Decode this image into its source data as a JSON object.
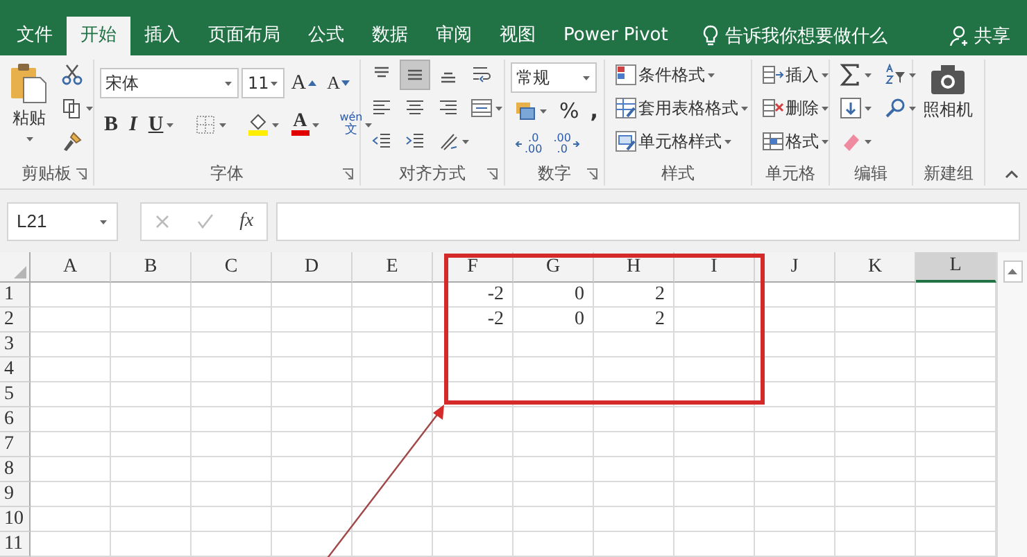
{
  "tabs": [
    {
      "label": "文件",
      "selected": false
    },
    {
      "label": "开始",
      "selected": true
    },
    {
      "label": "插入",
      "selected": false
    },
    {
      "label": "页面布局",
      "selected": false
    },
    {
      "label": "公式",
      "selected": false
    },
    {
      "label": "数据",
      "selected": false
    },
    {
      "label": "审阅",
      "selected": false
    },
    {
      "label": "视图",
      "selected": false
    },
    {
      "label": "Power Pivot",
      "selected": false
    }
  ],
  "tell_me": "告诉我你想要做什么",
  "share": "共享",
  "clipboard": {
    "paste": "粘贴",
    "label": "剪贴板"
  },
  "font": {
    "name": "宋体",
    "size": "11",
    "grow": "A",
    "shrink": "A",
    "bold": "B",
    "italic": "I",
    "underline": "U",
    "color_letter": "A",
    "phonetic_top": "wén",
    "phonetic_bottom": "文",
    "label": "字体"
  },
  "alignment": {
    "vertical": [
      {
        "selected": false
      },
      {
        "selected": true
      },
      {
        "selected": false
      }
    ],
    "label": "对齐方式"
  },
  "number": {
    "format": "常规",
    "percent": "%",
    "comma": ",",
    "increase_decimal": [
      ".0",
      ".00"
    ],
    "decrease_decimal": [
      ".00",
      ".0"
    ],
    "label": "数字"
  },
  "styles": {
    "items": [
      "条件格式",
      "套用表格格式",
      "单元格样式"
    ],
    "label": "样式"
  },
  "cells": {
    "items": [
      "插入",
      "删除",
      "格式"
    ],
    "label": "单元格"
  },
  "editing": {
    "label": "编辑"
  },
  "new_group": {
    "camera": "照相机",
    "label": "新建组"
  },
  "formula_bar": {
    "name_box": "L21",
    "function": "fx"
  },
  "sheet": {
    "columns": [
      {
        "label": "A",
        "selected": false
      },
      {
        "label": "B",
        "selected": false
      },
      {
        "label": "C",
        "selected": false
      },
      {
        "label": "D",
        "selected": false
      },
      {
        "label": "E",
        "selected": false
      },
      {
        "label": "F",
        "selected": false
      },
      {
        "label": "G",
        "selected": false
      },
      {
        "label": "H",
        "selected": false
      },
      {
        "label": "I",
        "selected": false
      },
      {
        "label": "J",
        "selected": false
      },
      {
        "label": "K",
        "selected": false
      },
      {
        "label": "L",
        "selected": true
      }
    ],
    "rows": [
      {
        "label": "1",
        "cells": [
          null,
          null,
          null,
          null,
          null,
          "-2",
          "0",
          "2"
        ]
      },
      {
        "label": "2",
        "cells": [
          null,
          null,
          null,
          null,
          null,
          "-2",
          "0",
          "2"
        ]
      },
      {
        "label": "3"
      },
      {
        "label": "4"
      },
      {
        "label": "5"
      },
      {
        "label": "6"
      },
      {
        "label": "7"
      },
      {
        "label": "8"
      },
      {
        "label": "9"
      },
      {
        "label": "10"
      },
      {
        "label": "11"
      }
    ]
  }
}
